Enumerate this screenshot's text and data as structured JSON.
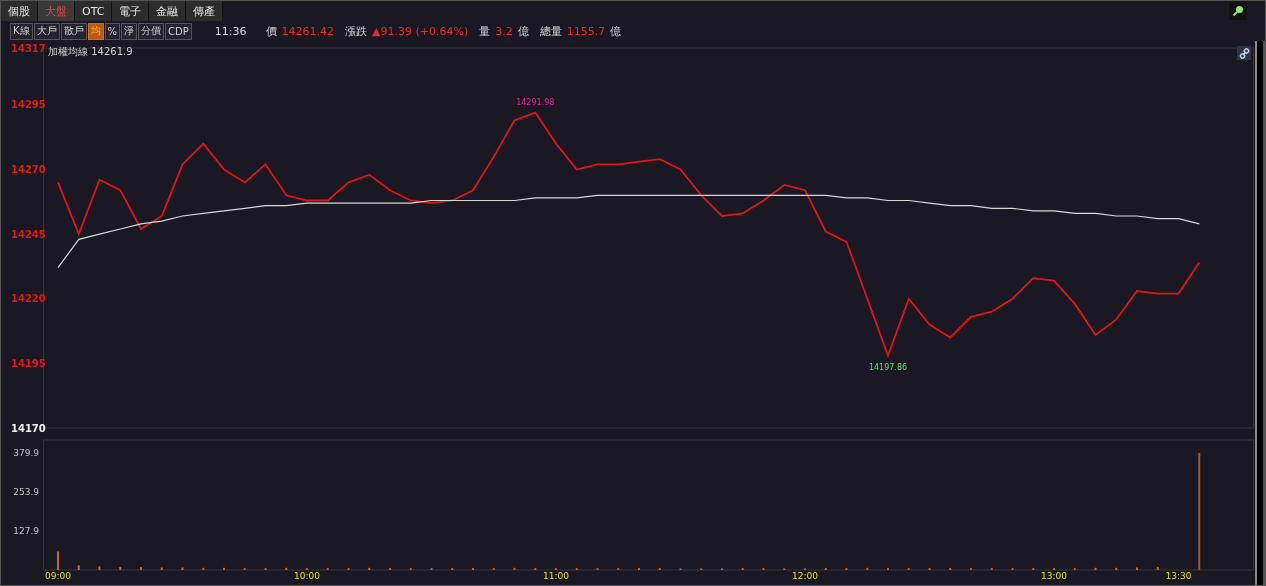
{
  "tabs": [
    {
      "label": "個股",
      "selected": false
    },
    {
      "label": "大盤",
      "selected": true
    },
    {
      "label": "OTC",
      "selected": false
    },
    {
      "label": "電子",
      "selected": false
    },
    {
      "label": "金融",
      "selected": false
    },
    {
      "label": "傳產",
      "selected": false
    }
  ],
  "toolbar": {
    "buttons": [
      {
        "label": "K線",
        "selected": false
      },
      {
        "label": "大戶",
        "selected": false
      },
      {
        "label": "散戶",
        "selected": false
      },
      {
        "label": "均",
        "selected": true
      },
      {
        "label": "%",
        "selected": false
      },
      {
        "label": "淨",
        "selected": false
      },
      {
        "label": "分價",
        "selected": false
      },
      {
        "label": "CDP",
        "selected": false
      }
    ],
    "quote": {
      "time": "11:36",
      "price_label": "價",
      "price": "14261.42",
      "change_label": "漲跌",
      "change": "▲91.39 (+0.64%)",
      "volume_label": "量",
      "volume": "3.2",
      "volume_unit": "億",
      "total_label": "總量",
      "total": "1155.7",
      "total_unit": "億"
    }
  },
  "price_chart": {
    "legend": "加權均線 14261.9",
    "chart_data": {
      "type": "line",
      "series": [
        {
          "color": "#e0141e",
          "values": [
            14265,
            14245,
            14266,
            14262,
            14247,
            14252,
            14272,
            14280,
            14270,
            14265,
            14272,
            14260,
            14258,
            14258,
            14265,
            14268,
            14262,
            14258,
            14257,
            14258,
            14262,
            14275,
            14289,
            14292,
            14280,
            14270,
            14272,
            14272,
            14273,
            14274,
            14270,
            14260,
            14252,
            14253,
            14258,
            14264,
            14262,
            14246,
            14242,
            14220,
            14198,
            14220,
            14210,
            14205,
            14213,
            14215,
            14220,
            14228,
            14227,
            14218,
            14206,
            14212,
            14223,
            14222,
            14222,
            14234
          ]
        },
        {
          "color": "#d8d8d8",
          "values": [
            14232,
            14243,
            14245,
            14247,
            14249,
            14250,
            14252,
            14253,
            14254,
            14255,
            14256,
            14256,
            14257,
            14257,
            14257,
            14257,
            14257,
            14257,
            14258,
            14258,
            14258,
            14258,
            14258,
            14259,
            14259,
            14259,
            14260,
            14260,
            14260,
            14260,
            14260,
            14260,
            14260,
            14260,
            14260,
            14260,
            14260,
            14260,
            14259,
            14259,
            14258,
            14258,
            14257,
            14256,
            14256,
            14255,
            14255,
            14254,
            14254,
            14253,
            14253,
            14252,
            14252,
            14251,
            14251,
            14249
          ]
        }
      ],
      "ylim": [
        14170,
        14317
      ],
      "yticks": [
        14170,
        14195,
        14220,
        14245,
        14270,
        14295,
        14317
      ],
      "annotations": [
        {
          "y": 14292,
          "text": "14291.98"
        },
        {
          "y": 14198,
          "text": "14197.86"
        }
      ]
    }
  },
  "volume_chart": {
    "chart_data": {
      "type": "bar",
      "categories": [
        "09:00",
        null,
        null,
        null,
        null,
        null,
        null,
        null,
        null,
        null,
        null,
        null,
        "10:00",
        null,
        null,
        null,
        null,
        null,
        null,
        null,
        null,
        null,
        null,
        null,
        "11:00",
        null,
        null,
        null,
        null,
        null,
        null,
        null,
        null,
        null,
        null,
        null,
        "12:00",
        null,
        null,
        null,
        null,
        null,
        null,
        null,
        null,
        null,
        null,
        null,
        "13:00",
        null,
        null,
        null,
        null,
        null,
        "13:30",
        null
      ],
      "values": [
        60,
        15,
        12,
        10,
        9,
        8,
        8,
        7,
        7,
        6,
        6,
        7,
        6,
        6,
        6,
        7,
        6,
        6,
        6,
        6,
        6,
        6,
        7,
        6,
        6,
        6,
        6,
        6,
        6,
        6,
        5,
        5,
        5,
        6,
        6,
        5,
        5,
        6,
        6,
        7,
        6,
        6,
        6,
        6,
        6,
        6,
        6,
        6,
        6,
        6,
        7,
        7,
        8,
        10,
        null,
        380
      ],
      "ylim": [
        0,
        422
      ],
      "yticks": [
        127.9,
        253.9,
        379.9
      ]
    }
  }
}
